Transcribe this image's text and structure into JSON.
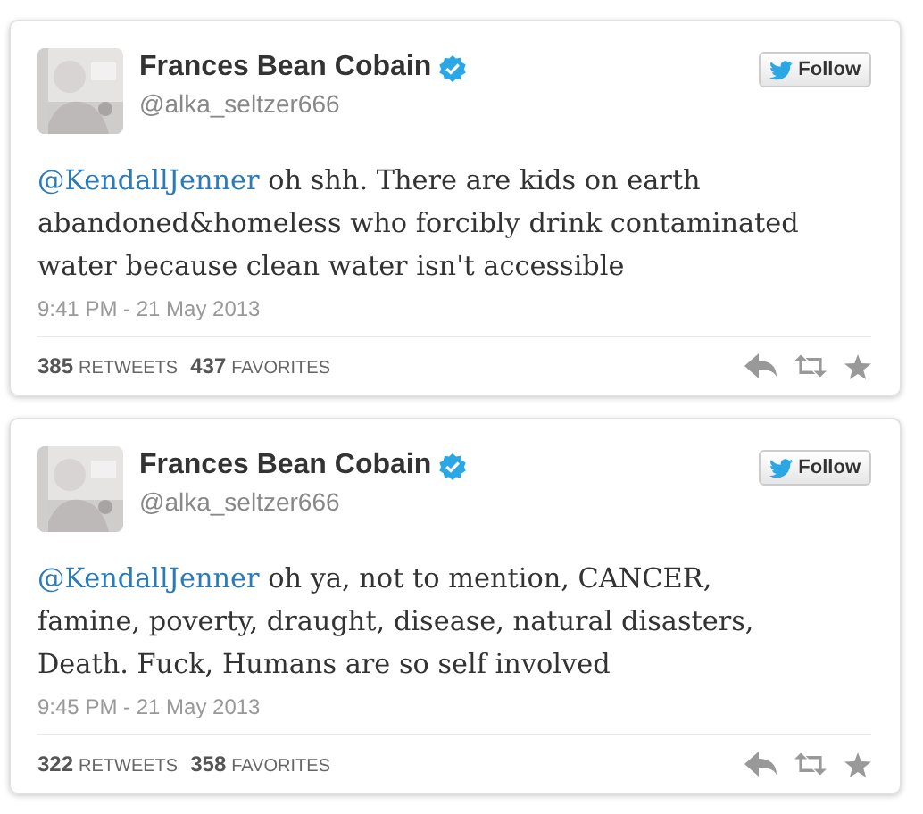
{
  "tweets": [
    {
      "author": {
        "name": "Frances Bean Cobain",
        "verified": true,
        "handle": "@alka_seltzer666"
      },
      "follow_button": "Follow",
      "mention": "@KendallJenner",
      "text": " oh shh. There are kids on earth abandoned&homeless who forcibly drink contaminated water because clean water isn't accessible",
      "timestamp": "9:41 PM - 21 May 2013",
      "stats": [
        {
          "count": "385",
          "label": "RETWEETS"
        },
        {
          "count": "437",
          "label": "FAVORITES"
        }
      ]
    },
    {
      "author": {
        "name": "Frances Bean Cobain",
        "verified": true,
        "handle": "@alka_seltzer666"
      },
      "follow_button": "Follow",
      "mention": "@KendallJenner",
      "text": " oh ya, not to mention, CANCER, famine, poverty, draught, disease, natural disasters, Death. Fuck, Humans are so self involved",
      "timestamp": "9:45 PM - 21 May 2013",
      "stats": [
        {
          "count": "322",
          "label": "RETWEETS"
        },
        {
          "count": "358",
          "label": "FAVORITES"
        }
      ]
    }
  ]
}
